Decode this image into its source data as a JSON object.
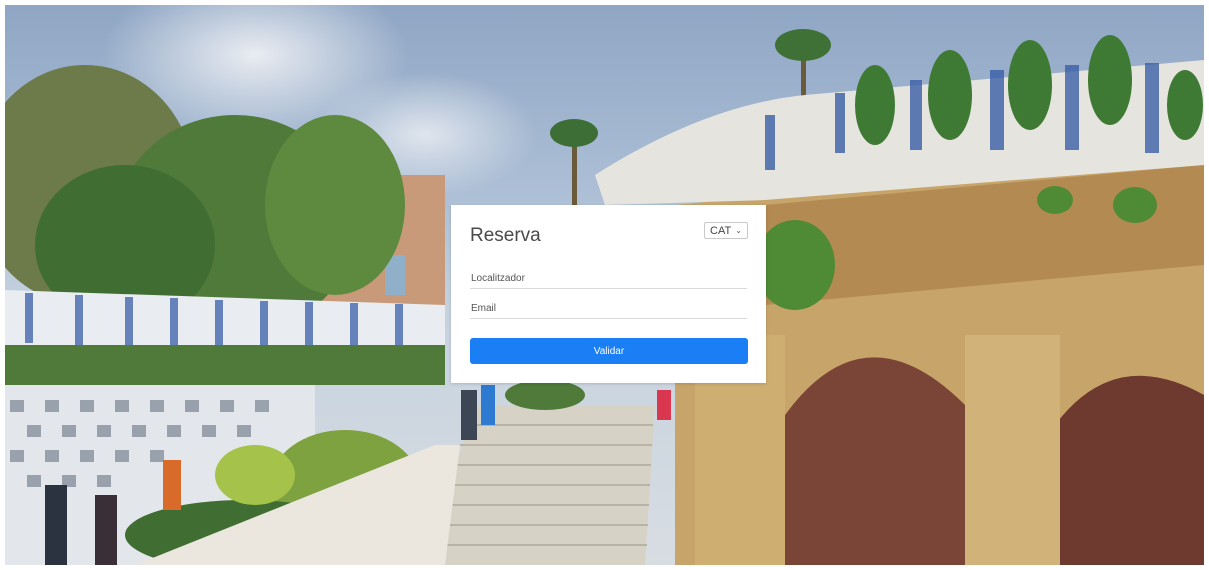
{
  "reservation": {
    "title": "Reserva",
    "language": "CAT",
    "locator_placeholder": "Localitzador",
    "email_placeholder": "Email",
    "validate_label": "Validar"
  },
  "colors": {
    "primary": "#1a7ef5",
    "card_bg": "#ffffff",
    "title_text": "#4a4a4a"
  },
  "icons": {
    "language_dropdown": "chevron-down-icon"
  }
}
